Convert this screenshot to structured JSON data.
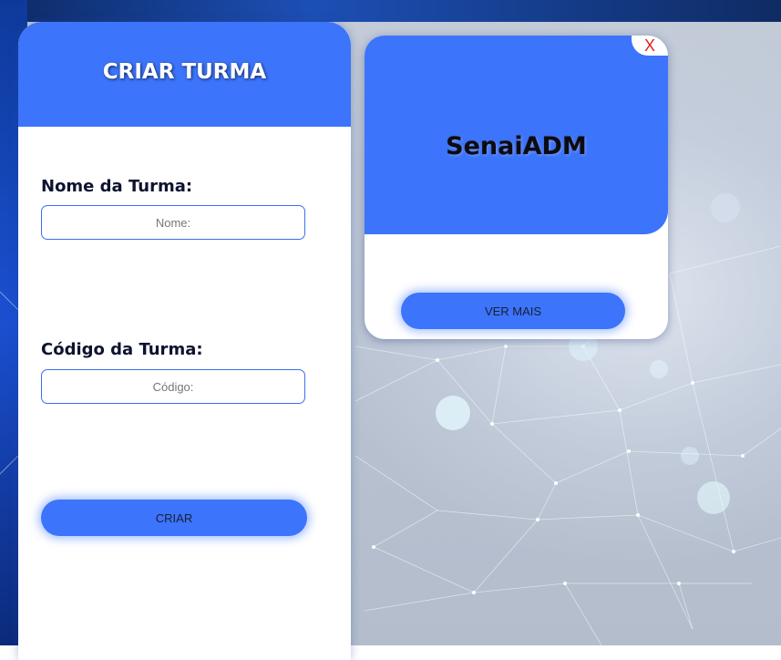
{
  "create_panel": {
    "title": "CRIAR TURMA",
    "name_label": "Nome da Turma:",
    "name_placeholder": "Nome:",
    "code_label": "Código da Turma:",
    "code_placeholder": "Código:",
    "submit_label": "CRIAR"
  },
  "class_card": {
    "title": "SenaiADM",
    "close_label": "X",
    "more_label": "VER MAIS"
  },
  "colors": {
    "accent": "#3c74fb",
    "close": "#e62020"
  }
}
